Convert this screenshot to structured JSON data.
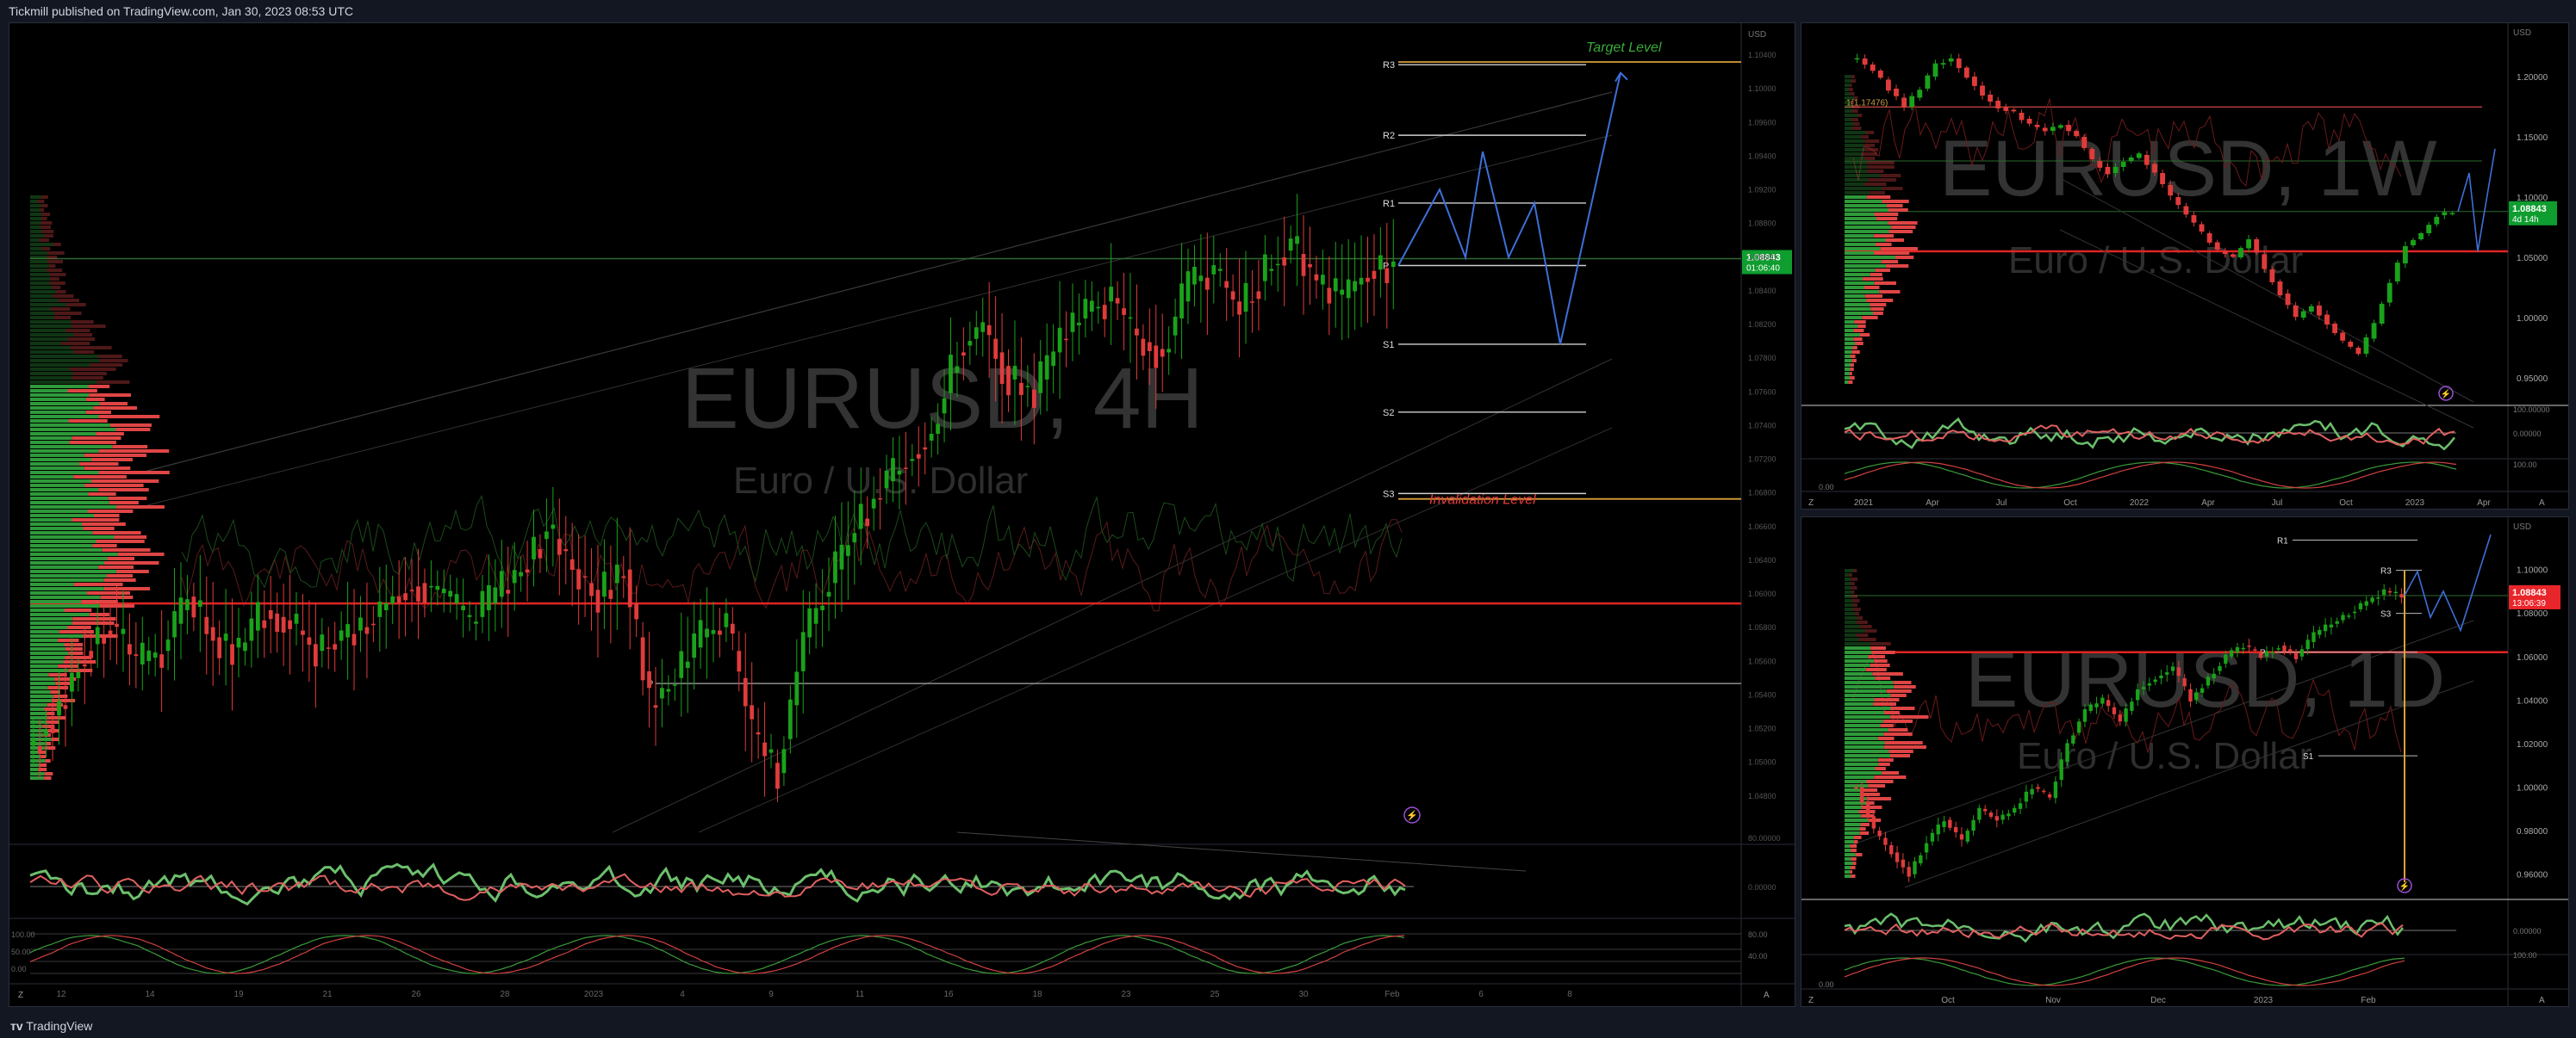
{
  "header": {
    "published": "Tickmill published on TradingView.com, Jan 30, 2023 08:53 UTC"
  },
  "footer": {
    "brand": "TradingView"
  },
  "colors": {
    "up": "#089981",
    "green": "#1aa21a",
    "red": "#e03b3b",
    "blue": "#3d6fd8",
    "target": "#d9a13a",
    "badge": "#0f9d2f",
    "badge_red": "#e8252a",
    "watermark": "#3a3a3a"
  },
  "icons": [
    "tradingview-logo-icon",
    "lightning-icon",
    "auto-scale-button",
    "log-scale-button"
  ],
  "panels": {
    "main": {
      "symbol": "EURUSD, 4H",
      "description": "Euro / U.S. Dollar",
      "currency": "USD",
      "price_badge": "1.08843",
      "countdown": "01:06:40",
      "target_label": "Target Level",
      "invalidation_label": "Invalidation Level",
      "pivots": [
        "R3",
        "R2",
        "R1",
        "P",
        "S1",
        "S2",
        "S3",
        "P"
      ],
      "price_ticks": [
        "1.10400",
        "1.10000",
        "1.09600",
        "1.09400",
        "1.09200",
        "1.08800",
        "1.08600",
        "1.08400",
        "1.08200",
        "1.07800",
        "1.07600",
        "1.07400",
        "1.07200",
        "1.06800",
        "1.06600",
        "1.06400",
        "1.06000",
        "1.05800",
        "1.05600",
        "1.05400",
        "1.05200",
        "1.05000",
        "1.04800"
      ],
      "time_ticks": [
        "12",
        "14",
        "19",
        "21",
        "26",
        "28",
        "2023",
        "4",
        "9",
        "11",
        "16",
        "18",
        "23",
        "25",
        "30",
        "Feb",
        "6",
        "8"
      ],
      "osc1_ticks": [
        "80.00000",
        "0.00000"
      ],
      "osc2_ticks_left": [
        "100.00",
        "50.00",
        "0.00"
      ],
      "osc2_ticks_right": [
        "80.00",
        "40.00"
      ],
      "scale_buttons": [
        "Z",
        "A"
      ]
    },
    "weekly": {
      "symbol": "EURUSD, 1W",
      "description": "Euro / U.S. Dollar",
      "currency": "USD",
      "price_badge": "1.08843",
      "countdown": "4d 14h",
      "fib_label": "1(1.17476)",
      "price_ticks": [
        "1.20000",
        "1.15000",
        "1.10000",
        "1.05000",
        "1.00000",
        "0.95000"
      ],
      "time_ticks": [
        "2021",
        "Apr",
        "Jul",
        "Oct",
        "2022",
        "Apr",
        "Jul",
        "Oct",
        "2023",
        "Apr"
      ],
      "osc1_ticks": [
        "100.00000",
        "0.00000"
      ],
      "osc2_ticks": [
        "100.00",
        "0.00"
      ],
      "scale_buttons": [
        "Z",
        "A"
      ]
    },
    "daily": {
      "symbol": "EURUSD, 1D",
      "description": "Euro / U.S. Dollar",
      "currency": "USD",
      "price_badge": "1.08843",
      "countdown": "13:06:39",
      "pivots": [
        "R1",
        "R3",
        "S3",
        "P",
        "S1"
      ],
      "price_ticks": [
        "1.10000",
        "1.08000",
        "1.06000",
        "1.04000",
        "1.02000",
        "1.00000",
        "0.98000",
        "0.96000"
      ],
      "time_ticks": [
        "Oct",
        "Nov",
        "Dec",
        "2023",
        "Feb"
      ],
      "osc1_ticks": [
        "0.00000"
      ],
      "osc2_ticks": [
        "100.00",
        "0.00"
      ],
      "scale_buttons": [
        "Z",
        "A"
      ]
    }
  },
  "chart_data": [
    {
      "type": "candlestick",
      "title": "EURUSD, 4H",
      "ylim": [
        1.046,
        1.106
      ],
      "series": [
        {
          "name": "EURUSD close (approx.)",
          "values": [
            1.053,
            1.056,
            1.06,
            1.062,
            1.059,
            1.06,
            1.064,
            1.061,
            1.06,
            1.063,
            1.062,
            1.06,
            1.061,
            1.062,
            1.064,
            1.065,
            1.064,
            1.062,
            1.064,
            1.066,
            1.069,
            1.066,
            1.064,
            1.066,
            1.056,
            1.058,
            1.061,
            1.062,
            1.054,
            1.051,
            1.061,
            1.065,
            1.069,
            1.072,
            1.074,
            1.076,
            1.082,
            1.084,
            1.08,
            1.079,
            1.083,
            1.085,
            1.086,
            1.083,
            1.082,
            1.087,
            1.088,
            1.085,
            1.088,
            1.09,
            1.087,
            1.086,
            1.088,
            1.0884
          ]
        }
      ],
      "levels": {
        "R3": 1.1032,
        "R2": 1.098,
        "R1": 1.093,
        "P": 1.0884,
        "S1": 1.0826,
        "S2": 1.0776,
        "S3": 1.0716,
        "P_prev": 1.0576,
        "target": 1.1034,
        "invalidation": 1.0712
      },
      "projection": [
        1.0884,
        1.094,
        1.089,
        1.0968,
        1.089,
        1.093,
        1.0826,
        1.1026
      ]
    },
    {
      "type": "candlestick",
      "title": "EURUSD, 1W",
      "ylim": [
        0.93,
        1.23
      ],
      "series": [
        {
          "name": "EURUSD close (approx.)",
          "values": [
            1.215,
            1.205,
            1.19,
            1.175,
            1.19,
            1.21,
            1.215,
            1.2,
            1.185,
            1.175,
            1.17,
            1.16,
            1.155,
            1.16,
            1.15,
            1.13,
            1.12,
            1.13,
            1.135,
            1.12,
            1.1,
            1.085,
            1.07,
            1.055,
            1.05,
            1.065,
            1.04,
            1.02,
            1.0,
            1.01,
            0.995,
            0.98,
            0.97,
            0.995,
            1.03,
            1.06,
            1.07,
            1.085,
            1.088
          ]
        }
      ],
      "levels": {
        "fib_1": 1.17476,
        "last": 1.08843
      }
    },
    {
      "type": "candlestick",
      "title": "EURUSD, 1D",
      "ylim": [
        0.95,
        1.12
      ],
      "series": [
        {
          "name": "EURUSD close (approx.)",
          "values": [
            1.0,
            0.98,
            0.97,
            0.96,
            0.975,
            0.985,
            0.975,
            0.99,
            0.985,
            0.99,
            1.0,
            0.995,
            1.02,
            1.035,
            1.04,
            1.03,
            1.045,
            1.05,
            1.055,
            1.04,
            1.05,
            1.06,
            1.065,
            1.06,
            1.065,
            1.06,
            1.07,
            1.075,
            1.08,
            1.085,
            1.09,
            1.088
          ]
        }
      ],
      "levels": {
        "R1": 1.1135,
        "R3": 1.0996,
        "S3": 1.0798,
        "P": 1.062,
        "S1": 1.0144,
        "last": 1.08843
      }
    }
  ]
}
